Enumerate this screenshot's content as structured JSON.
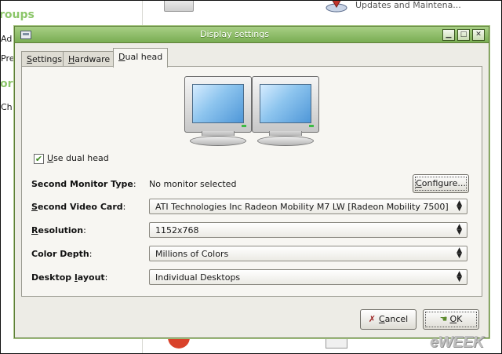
{
  "background": {
    "sidebar_heading_1": "roups",
    "sidebar_item_1": "Ad",
    "sidebar_item_2": "Pre",
    "sidebar_heading_2": "or",
    "sidebar_item_3": "Ch",
    "updates_label": "Updates and Maintena..."
  },
  "dialog": {
    "title": "Display settings",
    "tabs": [
      {
        "label": "Settings",
        "underline": "S",
        "rest": "ettings"
      },
      {
        "label": "Hardware",
        "underline": "H",
        "rest": "ardware"
      },
      {
        "label": "Dual head",
        "underline": "D",
        "rest": "ual head"
      }
    ],
    "active_tab": "Dual head",
    "use_dual_head": {
      "underline": "U",
      "rest": "se dual head",
      "checked": true
    },
    "rows": {
      "monitor_type": {
        "label": "Second Monitor Type",
        "value": "No monitor selected"
      },
      "video_card": {
        "label_u": "S",
        "label_rest": "econd Video Card",
        "value": "ATI Technologies Inc Radeon Mobility M7 LW [Radeon Mobility 7500]"
      },
      "resolution": {
        "label_u": "R",
        "label_rest": "esolution",
        "value": "1152x768"
      },
      "color_depth": {
        "label": "Color Depth",
        "value": "Millions of Colors"
      },
      "desktop_layout": {
        "label_a": "Desktop ",
        "label_u": "l",
        "label_b": "ayout",
        "value": "Individual Desktops"
      }
    },
    "configure_button": {
      "u": "C",
      "rest": "onfigure..."
    },
    "cancel_button": {
      "u": "C",
      "rest": "ancel"
    },
    "ok_button": {
      "u": "O",
      "rest": "K"
    }
  },
  "watermark": "eWEEK",
  "colors": {
    "titlebar": "#8fbe6a",
    "accent_green": "#8cc66a",
    "dialog_bg": "#edece6"
  }
}
